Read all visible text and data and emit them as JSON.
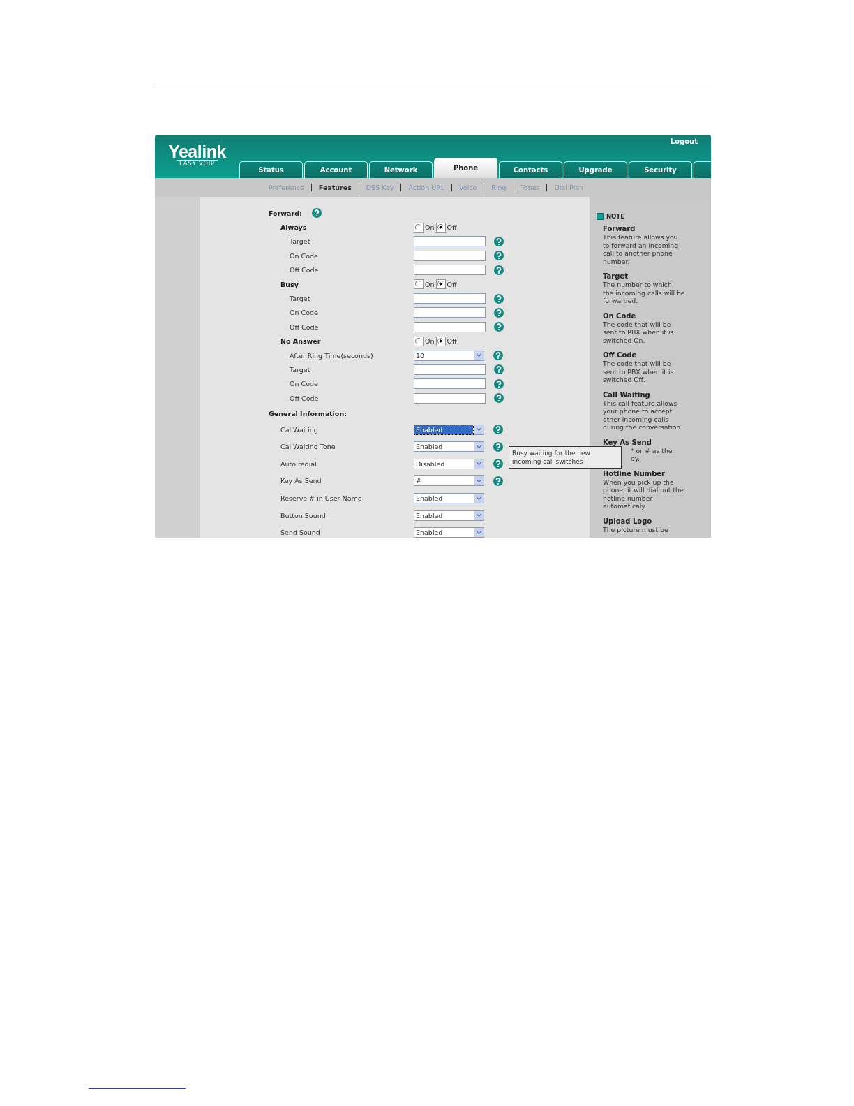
{
  "header": {
    "logo": "Yealink",
    "tagline": "EASY VOIP",
    "logout": "Logout"
  },
  "tabs": [
    {
      "label": "Status",
      "selected": false
    },
    {
      "label": "Account",
      "selected": false
    },
    {
      "label": "Network",
      "selected": false
    },
    {
      "label": "Phone",
      "selected": true
    },
    {
      "label": "Contacts",
      "selected": false
    },
    {
      "label": "Upgrade",
      "selected": false
    },
    {
      "label": "Security",
      "selected": false
    }
  ],
  "subtabs": [
    {
      "label": "Preference",
      "selected": false
    },
    {
      "label": "Features",
      "selected": true
    },
    {
      "label": "DSS Key",
      "selected": false
    },
    {
      "label": "Action URL",
      "selected": false
    },
    {
      "label": "Voice",
      "selected": false
    },
    {
      "label": "Ring",
      "selected": false
    },
    {
      "label": "Tones",
      "selected": false
    },
    {
      "label": "Dial Plan",
      "selected": false
    }
  ],
  "sections": [
    {
      "title": "Forward:",
      "help": true,
      "rows": [
        {
          "kind": "radio",
          "label": "Always",
          "options": [
            {
              "label": "On",
              "selected": false
            },
            {
              "label": "Off",
              "selected": true
            }
          ]
        },
        {
          "kind": "text",
          "label": "Target",
          "help": true
        },
        {
          "kind": "text",
          "label": "On Code",
          "help": true
        },
        {
          "kind": "text",
          "label": "Off Code",
          "help": true
        },
        {
          "kind": "radio",
          "label": "Busy",
          "options": [
            {
              "label": "On",
              "selected": false
            },
            {
              "label": "Off",
              "selected": true
            }
          ]
        },
        {
          "kind": "text",
          "label": "Target",
          "help": true
        },
        {
          "kind": "text",
          "label": "On Code",
          "help": true
        },
        {
          "kind": "text",
          "label": "Off Code",
          "help": true
        },
        {
          "kind": "radio",
          "label": "No Answer",
          "options": [
            {
              "label": "On",
              "selected": false
            },
            {
              "label": "Off",
              "selected": true
            }
          ]
        },
        {
          "kind": "select",
          "label": "After Ring Time(seconds)",
          "value": "10",
          "help": true,
          "focused": false
        },
        {
          "kind": "text",
          "label": "Target",
          "help": true
        },
        {
          "kind": "text",
          "label": "On Code",
          "help": true
        },
        {
          "kind": "text",
          "label": "Off Code",
          "help": true
        }
      ]
    },
    {
      "title": "General Information:",
      "help": false,
      "rows": [
        {
          "kind": "select",
          "label": "Cal Waiting",
          "value": "Enabled",
          "help": true,
          "focused": true
        },
        {
          "kind": "select",
          "label": "Cal Waiting Tone",
          "value": "Enabled",
          "help": true,
          "focused": false
        },
        {
          "kind": "select",
          "label": "Auto redial",
          "value": "Disabled",
          "help": true,
          "focused": false
        },
        {
          "kind": "select",
          "label": "Key As Send",
          "value": "#",
          "help": true,
          "focused": false
        },
        {
          "kind": "select",
          "label": "Reserve # in User Name",
          "value": "Enabled",
          "help": false,
          "focused": false
        },
        {
          "kind": "select",
          "label": "Button Sound",
          "value": "Enabled",
          "help": false,
          "focused": false
        },
        {
          "kind": "select",
          "label": "Send Sound",
          "value": "Enabled",
          "help": false,
          "focused": false
        }
      ]
    }
  ],
  "tooltip": {
    "text": "Busy waiting for the new incoming call switches"
  },
  "note": {
    "title": "NOTE",
    "items": [
      {
        "heading": "Forward",
        "lines": [
          "This feature allows you",
          "to forward an incoming",
          "call to another phone",
          "number."
        ],
        "covered": false
      },
      {
        "heading": "Target",
        "lines": [
          "The number to which",
          "the incoming calls will be",
          "forwarded."
        ],
        "covered": false
      },
      {
        "heading": "On Code",
        "lines": [
          "The code that will be",
          "sent to PBX when it is",
          "switched On."
        ],
        "covered": false
      },
      {
        "heading": "Off Code",
        "lines": [
          "The code that will be",
          "sent to PBX when it is",
          "switched Off."
        ],
        "covered": false
      },
      {
        "heading": "Call Waiting",
        "lines": [
          "This call feature allows",
          "your phone to accept",
          "other incoming calls",
          "during the conversation."
        ],
        "covered": false
      },
      {
        "heading": "Key As Send",
        "lines": [
          "* or # as the",
          "ey."
        ],
        "covered": true
      },
      {
        "heading": "Hotline Number",
        "lines": [
          "When you pick up the",
          "phone, it will dial out the",
          "hotline number",
          "automaticaly."
        ],
        "covered": false
      },
      {
        "heading": "Upload Logo",
        "lines": [
          "The picture must be"
        ],
        "covered": false
      }
    ]
  }
}
